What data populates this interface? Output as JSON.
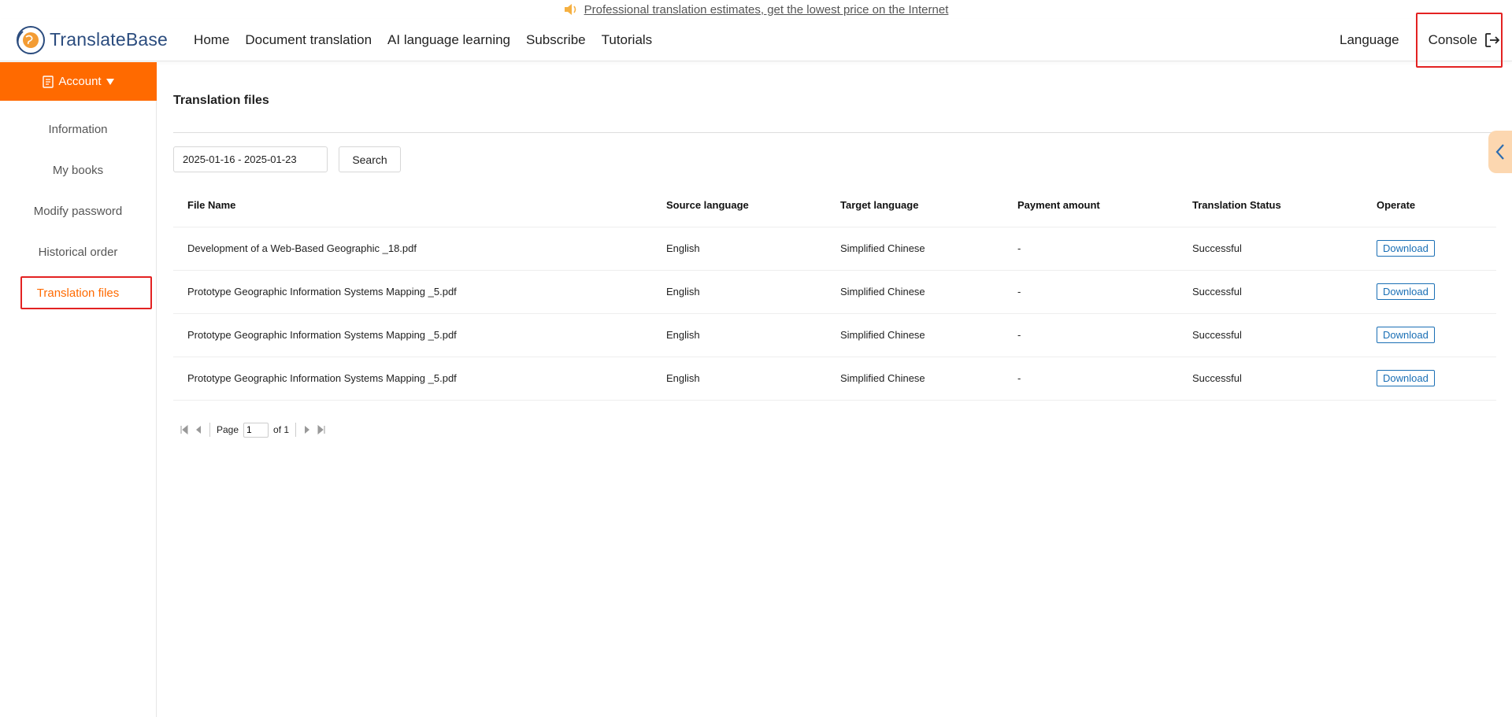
{
  "announcement": {
    "text": "Professional translation estimates, get the lowest price on the Internet",
    "icon": "speaker-icon"
  },
  "header": {
    "logo_text": "TranslateBase",
    "nav": [
      "Home",
      "Document translation",
      "AI language learning",
      "Subscribe",
      "Tutorials"
    ],
    "language_label": "Language",
    "console_label": "Console"
  },
  "sidebar": {
    "account_label": "Account",
    "items": [
      "Information",
      "My books",
      "Modify password",
      "Historical order",
      "Translation files"
    ],
    "active": "Translation files"
  },
  "main": {
    "title": "Translation files",
    "date_range": "2025-01-16 - 2025-01-23",
    "search_label": "Search",
    "columns": [
      "File Name",
      "Source language",
      "Target language",
      "Payment amount",
      "Translation Status",
      "Operate"
    ],
    "rows": [
      {
        "file": "Development of a Web-Based Geographic _18.pdf",
        "source": "English",
        "target": "Simplified Chinese",
        "amount": "-",
        "status": "Successful",
        "action": "Download"
      },
      {
        "file": "Prototype Geographic Information Systems Mapping _5.pdf",
        "source": "English",
        "target": "Simplified Chinese",
        "amount": "-",
        "status": "Successful",
        "action": "Download"
      },
      {
        "file": "Prototype Geographic Information Systems Mapping _5.pdf",
        "source": "English",
        "target": "Simplified Chinese",
        "amount": "-",
        "status": "Successful",
        "action": "Download"
      },
      {
        "file": "Prototype Geographic Information Systems Mapping _5.pdf",
        "source": "English",
        "target": "Simplified Chinese",
        "amount": "-",
        "status": "Successful",
        "action": "Download"
      }
    ],
    "pager": {
      "page_label": "Page",
      "current": "1",
      "of_label": "of 1"
    }
  },
  "colors": {
    "accent": "#ff6a00",
    "link": "#1a6fb5",
    "highlight": "#e32222",
    "logo": "#2b4c7e"
  }
}
